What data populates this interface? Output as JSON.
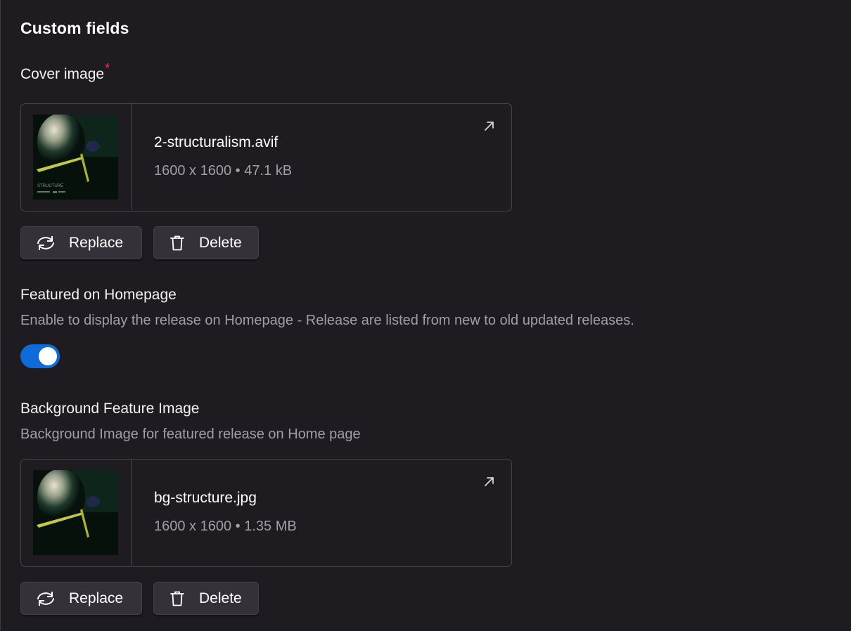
{
  "section": {
    "title": "Custom fields"
  },
  "cover_image": {
    "label": "Cover image",
    "required_marker": "*",
    "file": {
      "name": "2-structuralism.avif",
      "meta": "1600 x 1600 • 47.1 kB",
      "thumbnail_caption": "STRUCTURE"
    },
    "replace_label": "Replace",
    "delete_label": "Delete"
  },
  "featured": {
    "label": "Featured on Homepage",
    "description": "Enable to display the release on Homepage - Release are listed from new to old updated releases.",
    "enabled": true,
    "accent_color": "#0f6bd8"
  },
  "background_image": {
    "label": "Background Feature Image",
    "description": "Background Image for featured release on Home page",
    "file": {
      "name": "bg-structure.jpg",
      "meta": "1600 x 1600 • 1.35 MB"
    },
    "replace_label": "Replace",
    "delete_label": "Delete"
  },
  "icons": {
    "replace": "refresh-icon",
    "delete": "trash-icon",
    "open": "external-link-icon"
  },
  "colors": {
    "background": "#1e1c20",
    "required": "#f0385a",
    "muted_text": "#a19fa6"
  }
}
